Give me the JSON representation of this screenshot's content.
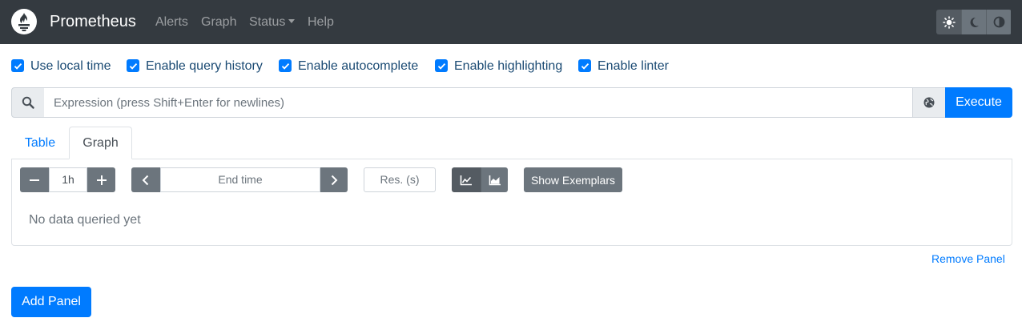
{
  "navbar": {
    "brand": "Prometheus",
    "links": {
      "alerts": "Alerts",
      "graph": "Graph",
      "status": "Status",
      "help": "Help"
    },
    "theme": {
      "options": [
        "light",
        "dark",
        "browser"
      ],
      "selected": "light",
      "icons": [
        "sun-icon",
        "moon-icon",
        "adjust-icon"
      ]
    }
  },
  "options": [
    {
      "label": "Use local time",
      "checked": true
    },
    {
      "label": "Enable query history",
      "checked": true
    },
    {
      "label": "Enable autocomplete",
      "checked": true
    },
    {
      "label": "Enable highlighting",
      "checked": true
    },
    {
      "label": "Enable linter",
      "checked": true
    }
  ],
  "query": {
    "placeholder": "Expression (press Shift+Enter for newlines)",
    "value": "",
    "execute_label": "Execute",
    "search_icon": "search-icon",
    "metrics_explorer_icon": "globe-icon"
  },
  "tabs": {
    "table": "Table",
    "graph": "Graph",
    "active": "graph"
  },
  "graph_controls": {
    "range_value": "1h",
    "end_time_placeholder": "End time",
    "resolution_placeholder": "Res. (s)",
    "chart_mode": "lines",
    "exemplars_label": "Show Exemplars"
  },
  "panel": {
    "status_text": "No data queried yet",
    "remove_label": "Remove Panel"
  },
  "add_panel_label": "Add Panel",
  "colors": {
    "navbar": "#343a40",
    "primary": "#007bff",
    "secondary": "#6c757d"
  }
}
